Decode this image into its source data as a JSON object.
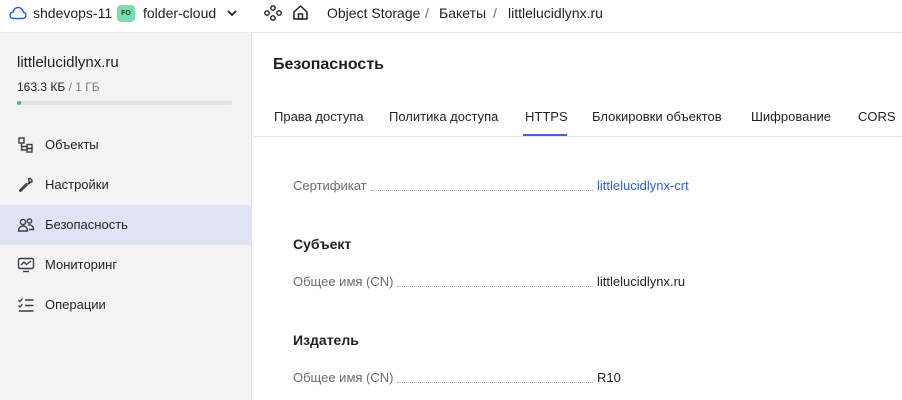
{
  "topbar": {
    "cloud_name": "shdevops-11",
    "folder_badge": "FO",
    "folder_name": "folder-cloud",
    "breadcrumbs": [
      "Object Storage",
      "Бакеты",
      "littlelucidlynx.ru"
    ],
    "separator": "/"
  },
  "sidebar": {
    "bucket_name": "littlelucidlynx.ru",
    "usage": "163.3 КБ",
    "usage_total": "/ 1 ГБ",
    "usage_fraction": 0.02,
    "items": [
      {
        "label": "Объекты",
        "icon": "objects-icon"
      },
      {
        "label": "Настройки",
        "icon": "wrench-icon"
      },
      {
        "label": "Безопасность",
        "icon": "users-icon",
        "active": true
      },
      {
        "label": "Мониторинг",
        "icon": "monitor-icon"
      },
      {
        "label": "Операции",
        "icon": "list-icon"
      }
    ]
  },
  "main": {
    "title": "Безопасность",
    "tabs": [
      "Права доступа",
      "Политика доступа",
      "HTTPS",
      "Блокировки объектов",
      "Шифрование",
      "CORS"
    ],
    "active_tab": "HTTPS",
    "certificate_label": "Сертификат",
    "certificate_value": "littlelucidlynx-crt",
    "subject_title": "Субъект",
    "subject_cn_label": "Общее имя (CN)",
    "subject_cn_value": "littlelucidlynx.ru",
    "issuer_title": "Издатель",
    "issuer_cn_label": "Общее имя (CN)",
    "issuer_cn_value": "R10"
  },
  "colors": {
    "accent": "#3f64d9",
    "link": "#2f62d4",
    "active_nav_bg": "#dfe3f4",
    "usage_bar": "#36c46b",
    "folder_badge_bg": "#7fdcae"
  }
}
